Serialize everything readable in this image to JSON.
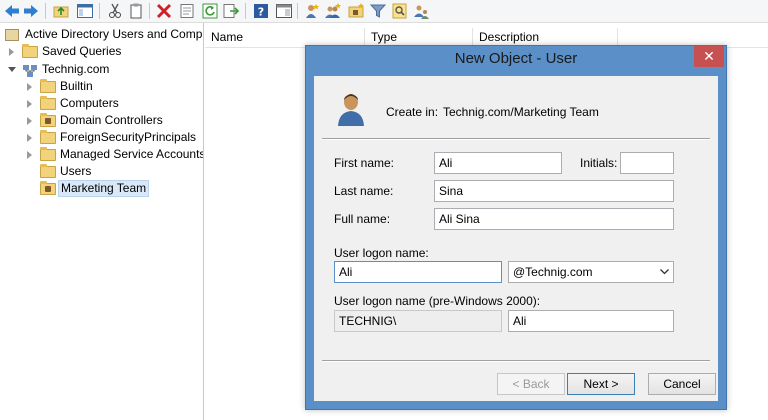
{
  "tree": {
    "root": "Active Directory Users and Comput",
    "saved_queries": "Saved Queries",
    "domain": "Technig.com",
    "children": [
      "Builtin",
      "Computers",
      "Domain Controllers",
      "ForeignSecurityPrincipals",
      "Managed Service Accounts",
      "Users",
      "Marketing Team"
    ]
  },
  "list": {
    "columns": [
      "Name",
      "Type",
      "Description"
    ]
  },
  "dialog": {
    "title": "New Object - User",
    "close": "✕",
    "create_in_label": "Create in:",
    "create_in_value": "Technig.com/Marketing Team",
    "first_name_label": "First name:",
    "first_name": "Ali",
    "initials_label": "Initials:",
    "initials": "",
    "last_name_label": "Last name:",
    "last_name": "Sina",
    "full_name_label": "Full name:",
    "full_name": "Ali Sina",
    "logon_label": "User logon name:",
    "logon": "Ali",
    "domain_suffix": "@Technig.com",
    "pre2000_label": "User logon name (pre-Windows 2000):",
    "pre2000_domain": "TECHNIG\\",
    "pre2000_name": "Ali",
    "back": "< Back",
    "next": "Next >",
    "cancel": "Cancel"
  }
}
